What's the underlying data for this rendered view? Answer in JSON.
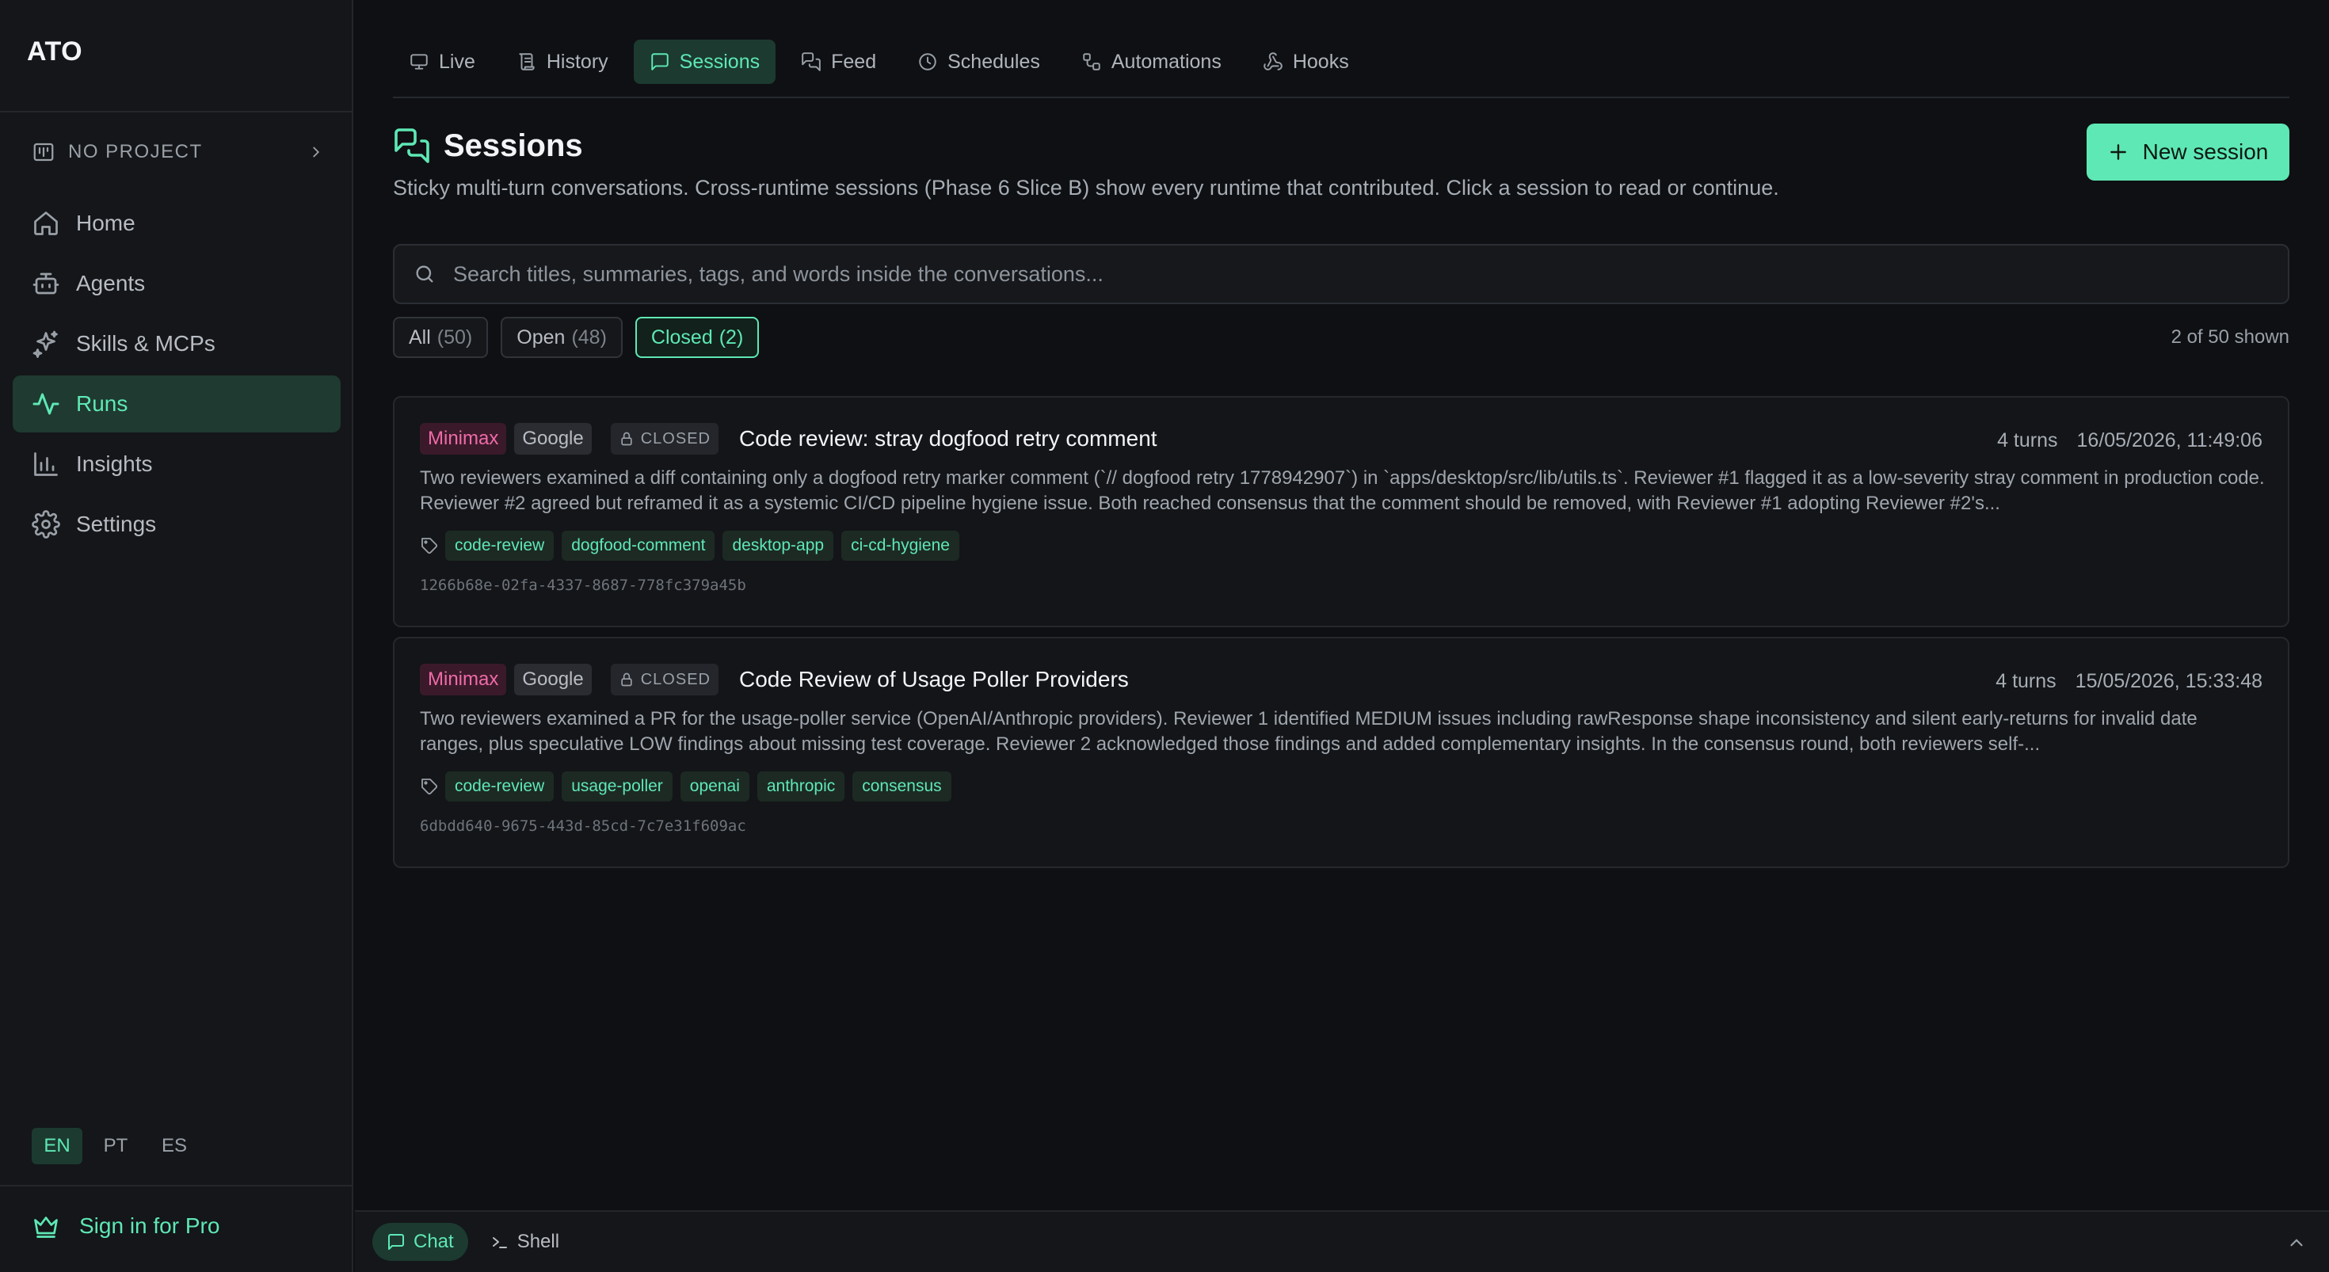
{
  "sidebar": {
    "logo": "ATO",
    "project_label": "NO PROJECT",
    "nav": [
      {
        "label": "Home",
        "icon": "home-icon"
      },
      {
        "label": "Agents",
        "icon": "bot-icon"
      },
      {
        "label": "Skills & MCPs",
        "icon": "sparkles-icon"
      },
      {
        "label": "Runs",
        "icon": "activity-icon",
        "active": true
      },
      {
        "label": "Insights",
        "icon": "bar-chart-icon"
      },
      {
        "label": "Settings",
        "icon": "gear-icon"
      }
    ],
    "languages": [
      "EN",
      "PT",
      "ES"
    ],
    "active_language": "EN",
    "signin_label": "Sign in for Pro"
  },
  "tabs": [
    {
      "label": "Live",
      "icon": "monitor-icon"
    },
    {
      "label": "History",
      "icon": "scroll-icon"
    },
    {
      "label": "Sessions",
      "icon": "message-square-icon",
      "active": true
    },
    {
      "label": "Feed",
      "icon": "feed-icon"
    },
    {
      "label": "Schedules",
      "icon": "clock-icon"
    },
    {
      "label": "Automations",
      "icon": "workflow-icon"
    },
    {
      "label": "Hooks",
      "icon": "webhook-icon"
    }
  ],
  "page": {
    "title": "Sessions",
    "subtitle": "Sticky multi-turn conversations. Cross-runtime sessions (Phase 6 Slice B) show every runtime that contributed. Click a session to read or continue.",
    "new_button_label": "New session"
  },
  "search": {
    "placeholder": "Search titles, summaries, tags, and words inside the conversations..."
  },
  "filters": [
    {
      "label": "All",
      "count": "(50)"
    },
    {
      "label": "Open",
      "count": "(48)"
    },
    {
      "label": "Closed",
      "count": "(2)",
      "active": true
    }
  ],
  "shown_text": "2 of 50 shown",
  "sessions": [
    {
      "runtimes": [
        "Minimax",
        "Google"
      ],
      "status": "CLOSED",
      "title": "Code review: stray dogfood retry comment",
      "turns": "4 turns",
      "timestamp": "16/05/2026, 11:49:06",
      "summary": "Two reviewers examined a diff containing only a dogfood retry marker comment (`// dogfood retry 1778942907`) in `apps/desktop/src/lib/utils.ts`. Reviewer #1 flagged it as a low-severity stray comment in production code. Reviewer #2 agreed but reframed it as a systemic CI/CD pipeline hygiene issue. Both reached consensus that the comment should be removed, with Reviewer #1 adopting Reviewer #2's...",
      "tags": [
        "code-review",
        "dogfood-comment",
        "desktop-app",
        "ci-cd-hygiene"
      ],
      "id": "1266b68e-02fa-4337-8687-778fc379a45b"
    },
    {
      "runtimes": [
        "Minimax",
        "Google"
      ],
      "status": "CLOSED",
      "title": "Code Review of Usage Poller Providers",
      "turns": "4 turns",
      "timestamp": "15/05/2026, 15:33:48",
      "summary": "Two reviewers examined a PR for the usage-poller service (OpenAI/Anthropic providers). Reviewer 1 identified MEDIUM issues including rawResponse shape inconsistency and silent early-returns for invalid date ranges, plus speculative LOW findings about missing test coverage. Reviewer 2 acknowledged those findings and added complementary insights. In the consensus round, both reviewers self-...",
      "tags": [
        "code-review",
        "usage-poller",
        "openai",
        "anthropic",
        "consensus"
      ],
      "id": "6dbdd640-9675-443d-85cd-7c7e31f609ac"
    }
  ],
  "bottombar": {
    "chat_label": "Chat",
    "shell_label": "Shell"
  },
  "colors": {
    "accent": "#5ee8b5",
    "background": "#0e1013",
    "sidebar": "#141619",
    "minimax_badge": "#f06aa8"
  }
}
